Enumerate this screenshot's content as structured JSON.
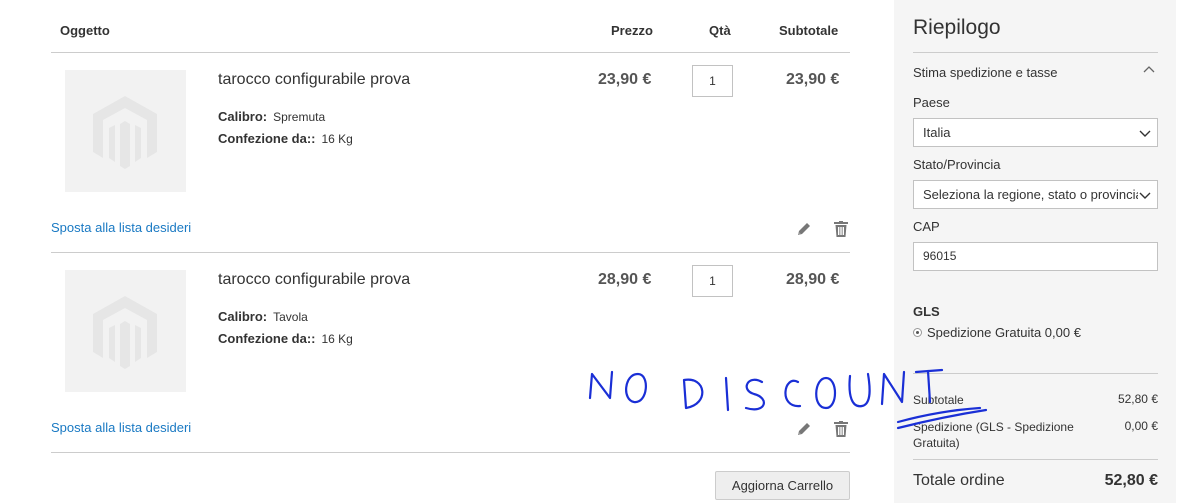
{
  "cart": {
    "headers": {
      "item": "Oggetto",
      "price": "Prezzo",
      "qty": "Qtà",
      "subtotal": "Subtotale"
    },
    "items": [
      {
        "name": "tarocco configurabile prova",
        "options": [
          {
            "label": "Calibro:",
            "value": "Spremuta"
          },
          {
            "label": "Confezione da::",
            "value": "16 Kg"
          }
        ],
        "price": "23,90 €",
        "qty": "1",
        "subtotal": "23,90 €",
        "wishlist_label": "Sposta alla lista desideri"
      },
      {
        "name": "tarocco configurabile prova",
        "options": [
          {
            "label": "Calibro:",
            "value": "Tavola"
          },
          {
            "label": "Confezione da::",
            "value": "16 Kg"
          }
        ],
        "price": "28,90 €",
        "qty": "1",
        "subtotal": "28,90 €",
        "wishlist_label": "Sposta alla lista desideri"
      }
    ],
    "update_label": "Aggiorna Carrello"
  },
  "summary": {
    "title": "Riepilogo",
    "shipping_section": "Stima spedizione e tasse",
    "country_label": "Paese",
    "country_value": "Italia",
    "region_label": "Stato/Provincia",
    "region_value": "Seleziona la regione, stato o provincia.",
    "zip_label": "CAP",
    "zip_value": "96015",
    "carrier": "GLS",
    "method": "Spedizione Gratuita 0,00 €",
    "subtotal_label": "Subtotale",
    "subtotal_value": "52,80 €",
    "shipping_label": "Spedizione (GLS - Spedizione Gratuita)",
    "shipping_value": "0,00 €",
    "total_label": "Totale ordine",
    "total_value": "52,80 €"
  },
  "annotation": {
    "text": "NO DISCOUNT",
    "color": "#1a2fd6"
  },
  "colors": {
    "link": "#1979c3",
    "summary_bg": "#f5f5f5"
  }
}
